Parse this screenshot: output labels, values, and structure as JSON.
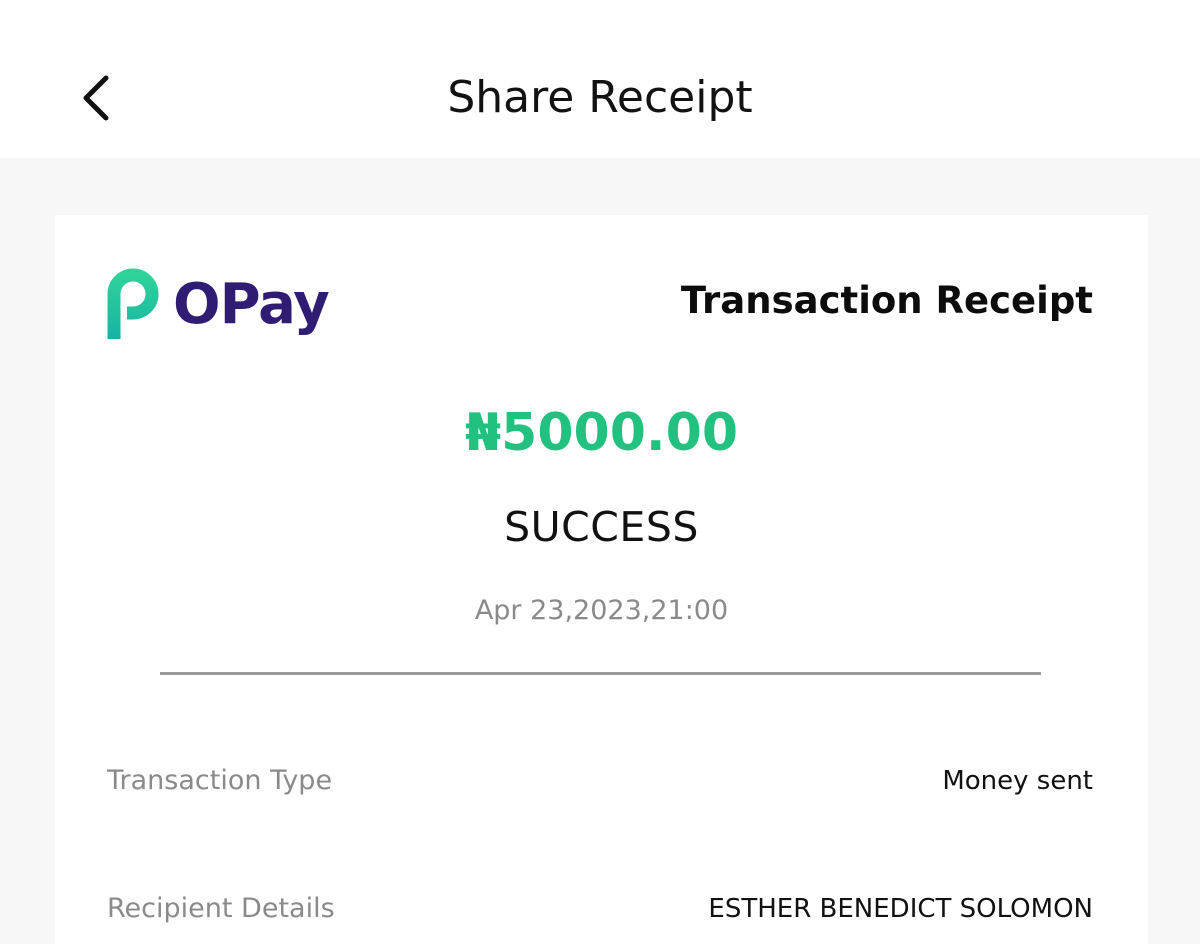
{
  "header": {
    "title": "Share Receipt",
    "back_icon": "chevron-left-icon"
  },
  "receipt": {
    "brand_name": "OPay",
    "brand_colors": {
      "primary": "#2e1d73",
      "accent": "#22c17f"
    },
    "title": "Transaction Receipt",
    "amount": "₦5000.00",
    "status": "SUCCESS",
    "datetime": "Apr 23,2023,21:00",
    "details": [
      {
        "label": "Transaction Type",
        "value": "Money sent"
      },
      {
        "label": "Recipient Details",
        "value": "ESTHER BENEDICT SOLOMON"
      }
    ]
  }
}
